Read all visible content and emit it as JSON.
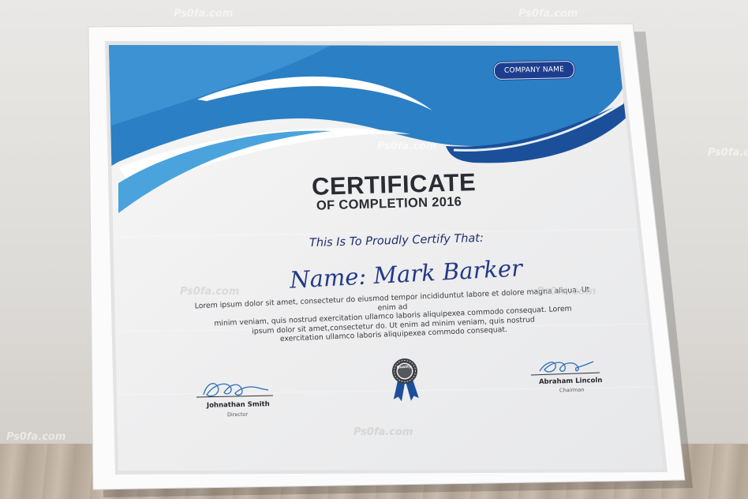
{
  "certificate": {
    "company_badge": "COMPANY NAME",
    "title": "CERTIFICATE",
    "subtitle": "OF COMPLETION 2016",
    "certify_line": "This Is To Proudly Certify That:",
    "name_line": "Name: Mark Barker",
    "body_lines": [
      "Lorem ipsum dolor sit amet, consectetur do eiusmod tempor incididuntut labore et dolore magna aliqua. Ut enim ad",
      "minim veniam, quis nostrud exercitation ullamco laboris aliquipexea commodo consequat. Lorem",
      "ipsum dolor sit amet,consectetur do. Ut enim ad minim veniam, quis nostrud",
      "exercitation ullamco laboris aliquipexea commodo consequat."
    ],
    "seal_text": "Quality",
    "signatures": [
      {
        "name": "Johnathan Smith",
        "role": "Director"
      },
      {
        "name": "Abraham Lincoln",
        "role": "Chairman"
      }
    ]
  },
  "watermark": {
    "text": "Ps0fa.com"
  },
  "colors": {
    "wave_light": "#4aa3dc",
    "wave_mid": "#2b7fc4",
    "wave_dark": "#1b4f9a",
    "ink_navy": "#1f2f6e"
  }
}
